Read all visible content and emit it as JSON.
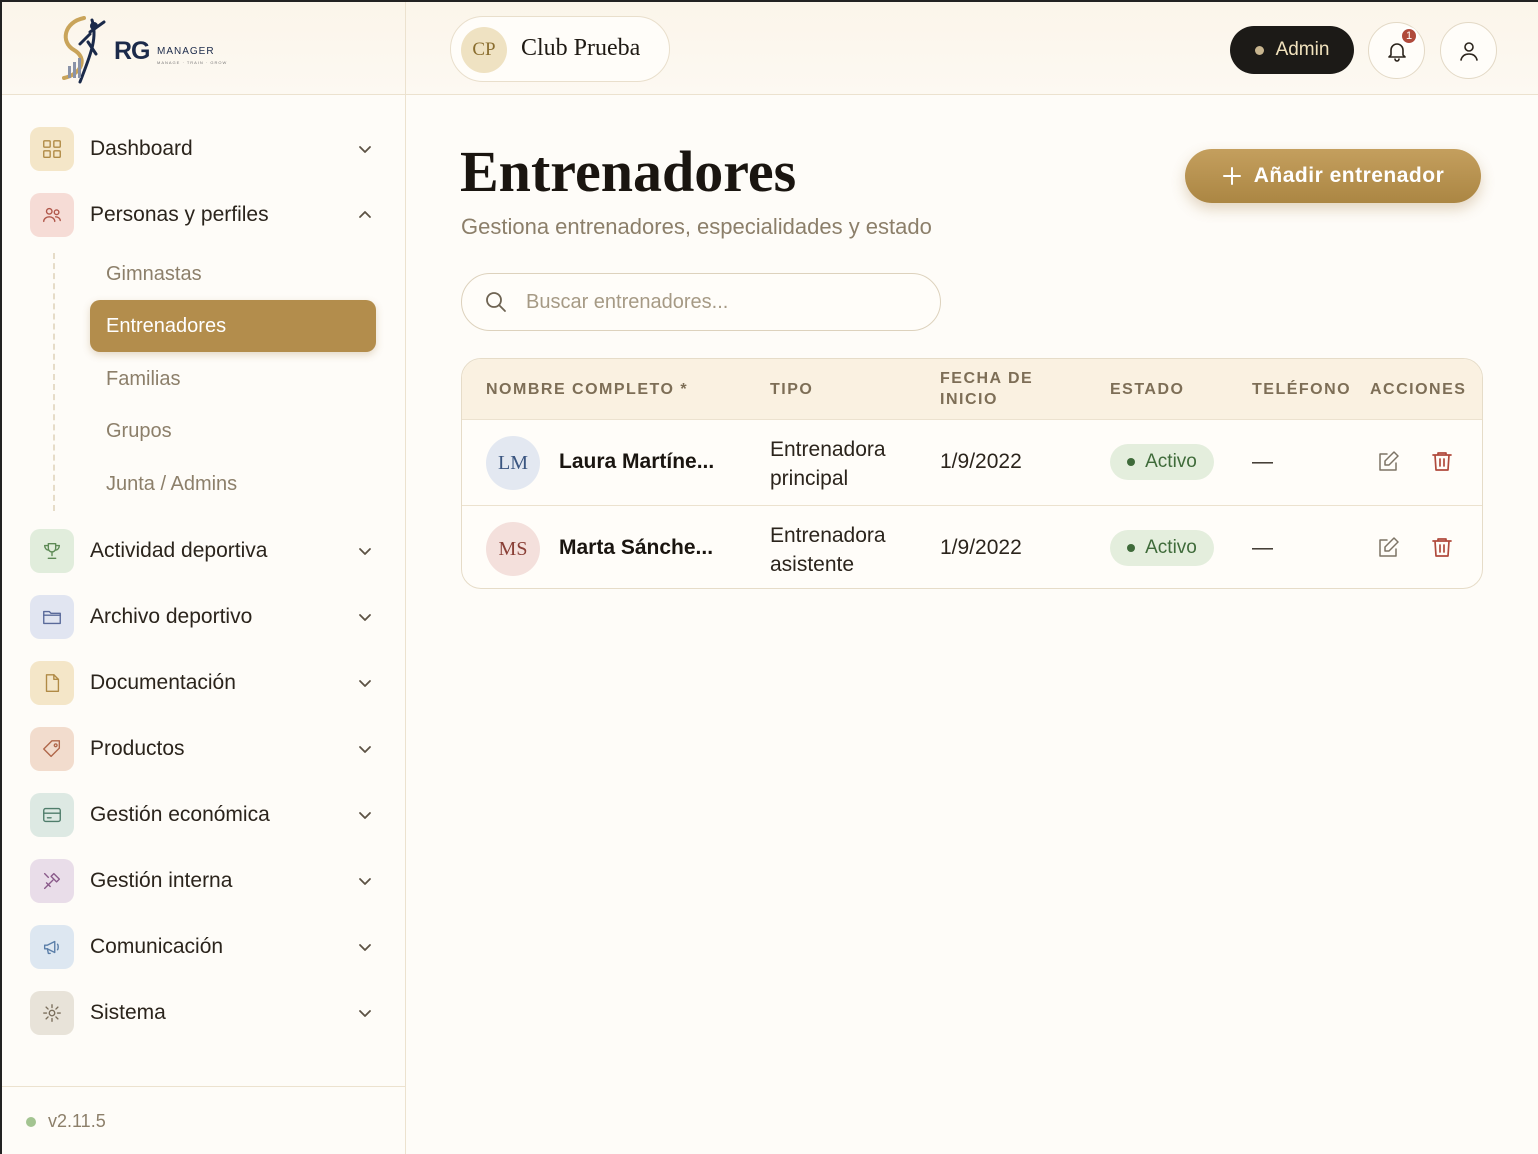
{
  "brand": {
    "name": "RG",
    "suffix": "MANAGER",
    "tagline": "MANAGE · TRAIN · GROW"
  },
  "club": {
    "initials": "CP",
    "name": "Club Prueba"
  },
  "header": {
    "role_label": "Admin",
    "notifications_count": "1"
  },
  "sidebar": {
    "items": [
      {
        "label": "Dashboard",
        "icon": "grid-icon",
        "color": "#f4e6c8",
        "expanded": false
      },
      {
        "label": "Personas y perfiles",
        "icon": "users-icon",
        "color": "#f6dcd6",
        "expanded": true
      },
      {
        "label": "Actividad deportiva",
        "icon": "trophy-icon",
        "color": "#e1eddc",
        "expanded": false
      },
      {
        "label": "Archivo deportivo",
        "icon": "folder-icon",
        "color": "#e1e5f1",
        "expanded": false
      },
      {
        "label": "Documentación",
        "icon": "document-icon",
        "color": "#f4e6c8",
        "expanded": false
      },
      {
        "label": "Productos",
        "icon": "tag-icon",
        "color": "#f2dccd",
        "expanded": false
      },
      {
        "label": "Gestión económica",
        "icon": "card-icon",
        "color": "#dde9e3",
        "expanded": false
      },
      {
        "label": "Gestión interna",
        "icon": "tools-icon",
        "color": "#e9dde9",
        "expanded": false
      },
      {
        "label": "Comunicación",
        "icon": "megaphone-icon",
        "color": "#dde7f1",
        "expanded": false
      },
      {
        "label": "Sistema",
        "icon": "gear-icon",
        "color": "#e8e3d9",
        "expanded": false
      }
    ],
    "sub_items": [
      {
        "label": "Gimnastas",
        "active": false
      },
      {
        "label": "Entrenadores",
        "active": true
      },
      {
        "label": "Familias",
        "active": false
      },
      {
        "label": "Grupos",
        "active": false
      },
      {
        "label": "Junta / Admins",
        "active": false
      }
    ],
    "version": "v2.11.5"
  },
  "main": {
    "title": "Entrenadores",
    "subtitle": "Gestiona entrenadores, especialidades y estado",
    "add_button_label": "Añadir entrenador",
    "search_placeholder": "Buscar entrenadores...",
    "table": {
      "columns": [
        "NOMBRE COMPLETO *",
        "TIPO",
        "FECHA DE INICIO",
        "ESTADO",
        "TELÉFONO",
        "ACCIONES"
      ],
      "rows": [
        {
          "initials": "LM",
          "avatar_bg": "#e3e8f1",
          "avatar_fg": "#3a5580",
          "name": "Laura Martíne...",
          "tipo": "Entrenadora principal",
          "fecha": "1/9/2022",
          "estado": "Activo",
          "telefono": "—"
        },
        {
          "initials": "MS",
          "avatar_bg": "#f4e0dc",
          "avatar_fg": "#8a3f36",
          "name": "Marta Sánche...",
          "tipo": "Entrenadora asistente",
          "fecha": "1/9/2022",
          "estado": "Activo",
          "telefono": "—"
        }
      ]
    }
  },
  "colors": {
    "accent": "#b38d4c",
    "status_active": "#3f6b3a",
    "delete": "#b04a3c"
  }
}
